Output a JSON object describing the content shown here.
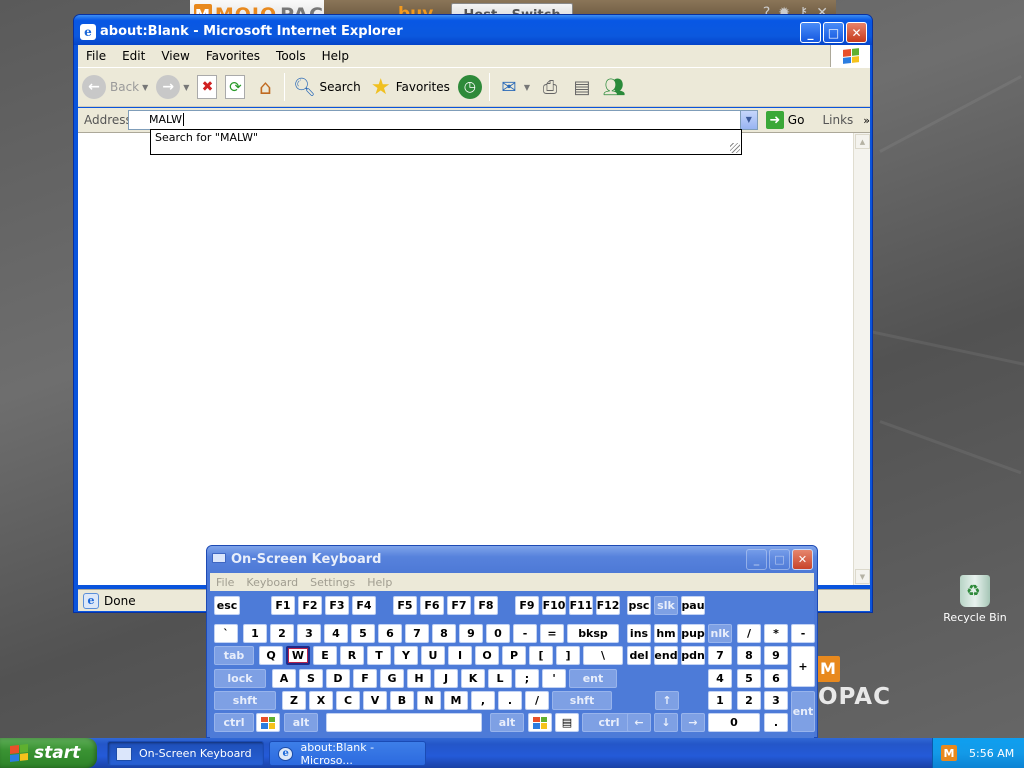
{
  "mojopac": {
    "logo_text": "MOJO",
    "logo_suffix": "PAC",
    "buy_label": "buy",
    "host_switch_label": "Host - Switch",
    "icons": [
      "help-icon",
      "settings-icon",
      "lock-icon",
      "close-icon"
    ]
  },
  "ie": {
    "title": "about:Blank - Microsoft Internet Explorer",
    "menu": [
      "File",
      "Edit",
      "View",
      "Favorites",
      "Tools",
      "Help"
    ],
    "toolbar": {
      "back_label": "Back",
      "search_label": "Search",
      "favorites_label": "Favorites"
    },
    "address_label": "Address",
    "address_value": "MALW",
    "go_label": "Go",
    "links_label": "Links",
    "autocomplete_text": "Search for \"MALW\"",
    "status_text": "Done"
  },
  "osk": {
    "title": "On-Screen Keyboard",
    "menu": [
      "File",
      "Keyboard",
      "Settings",
      "Help"
    ],
    "rows": {
      "fn": [
        "esc",
        "F1",
        "F2",
        "F3",
        "F4",
        "F5",
        "F6",
        "F7",
        "F8",
        "F9",
        "F10",
        "F11",
        "F12",
        "psc",
        "slk",
        "pau"
      ],
      "num": [
        "`",
        "1",
        "2",
        "3",
        "4",
        "5",
        "6",
        "7",
        "8",
        "9",
        "0",
        "-",
        "=",
        "bksp",
        "ins",
        "hm",
        "pup",
        "nlk",
        "/",
        "*",
        "-"
      ],
      "top": [
        "tab",
        "Q",
        "W",
        "E",
        "R",
        "T",
        "Y",
        "U",
        "I",
        "O",
        "P",
        "[",
        "]",
        "\\",
        "del",
        "end",
        "pdn",
        "7",
        "8",
        "9",
        "+"
      ],
      "home": [
        "lock",
        "A",
        "S",
        "D",
        "F",
        "G",
        "H",
        "J",
        "K",
        "L",
        ";",
        "'",
        "ent",
        "4",
        "5",
        "6"
      ],
      "bottom": [
        "shft",
        "Z",
        "X",
        "C",
        "V",
        "B",
        "N",
        "M",
        ",",
        ".",
        "/",
        "shft",
        "↑",
        "1",
        "2",
        "3",
        "ent"
      ],
      "space": [
        "ctrl",
        "alt",
        "alt",
        "ctrl",
        "←",
        "↓",
        "→",
        "0",
        "."
      ]
    },
    "active_key": "W"
  },
  "desktop": {
    "recycle_bin_label": "Recycle Bin",
    "mojo_desk_logo": "M",
    "mojo_desk_text": "OPAC"
  },
  "taskbar": {
    "start_label": "start",
    "tasks": [
      "On-Screen Keyboard",
      "about:Blank - Microso..."
    ],
    "clock": "5:56 AM"
  },
  "colors": {
    "xp_blue": "#0a54dc",
    "osk_blue": "#4a77d6",
    "mojo_orange": "#e8891e",
    "start_green": "#3a9333"
  }
}
